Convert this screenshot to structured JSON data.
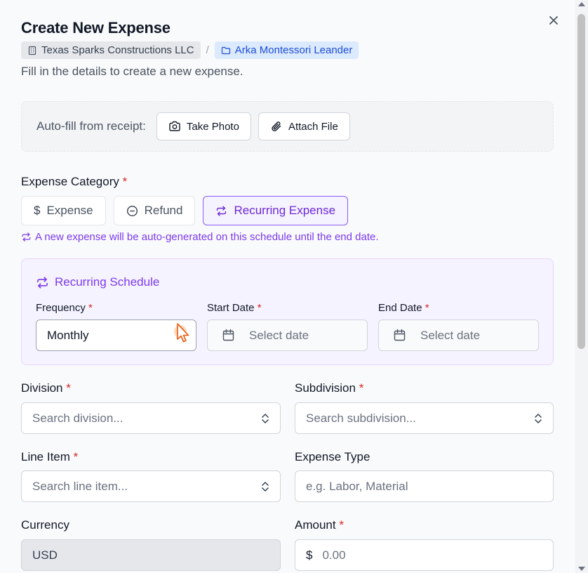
{
  "dialog": {
    "title": "Create New Expense",
    "subtitle": "Fill in the details to create a new expense.",
    "breadcrumb": {
      "company": "Texas Sparks Constructions LLC",
      "separator": "/",
      "project": "Arka Montessori Leander"
    }
  },
  "autofill": {
    "label": "Auto-fill from receipt:",
    "take_photo": "Take Photo",
    "attach_file": "Attach File"
  },
  "category": {
    "label": "Expense Category",
    "required_mark": "*",
    "options": [
      {
        "label": "Expense",
        "selected": false
      },
      {
        "label": "Refund",
        "selected": false
      },
      {
        "label": "Recurring Expense",
        "selected": true
      }
    ],
    "note": "A new expense will be auto-generated on this schedule until the end date."
  },
  "recurring": {
    "title": "Recurring Schedule",
    "frequency": {
      "label": "Frequency",
      "value": "Monthly"
    },
    "start_date": {
      "label": "Start Date",
      "placeholder": "Select date"
    },
    "end_date": {
      "label": "End Date",
      "placeholder": "Select date"
    }
  },
  "fields": {
    "division": {
      "label": "Division",
      "placeholder": "Search division..."
    },
    "subdivision": {
      "label": "Subdivision",
      "placeholder": "Search subdivision..."
    },
    "line_item": {
      "label": "Line Item",
      "placeholder": "Search line item..."
    },
    "expense_type": {
      "label": "Expense Type",
      "placeholder": "e.g. Labor, Material"
    },
    "currency": {
      "label": "Currency",
      "value": "USD"
    },
    "amount": {
      "label": "Amount",
      "prefix": "$",
      "placeholder": "0.00"
    }
  },
  "colors": {
    "accent": "#7c3aed",
    "required": "#dc2626",
    "project_badge": "#1d4ed8"
  }
}
